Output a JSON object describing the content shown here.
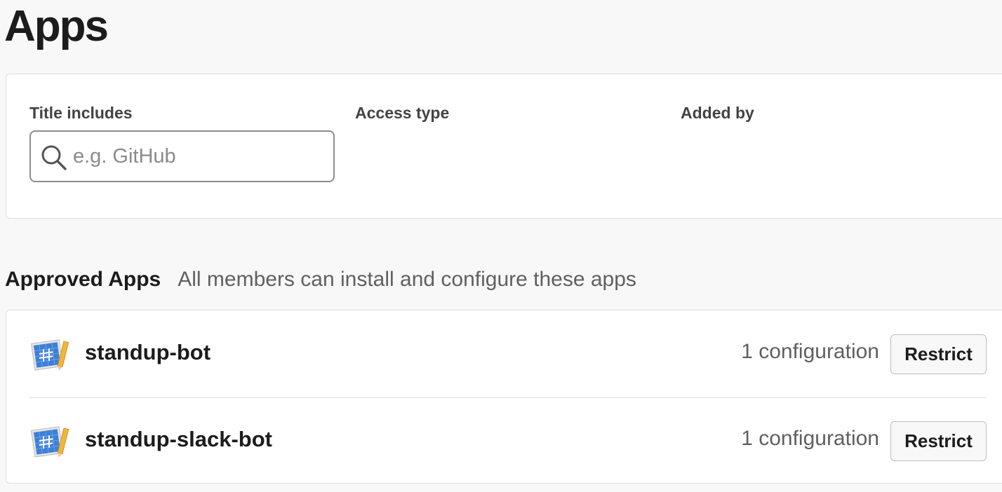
{
  "page": {
    "title": "Apps"
  },
  "filters": {
    "title_label": "Title includes",
    "title_placeholder": "e.g. GitHub",
    "title_value": "",
    "access_type_label": "Access type",
    "added_by_label": "Added by"
  },
  "approved": {
    "title": "Approved Apps",
    "subtitle": "All members can install and configure these apps",
    "apps": [
      {
        "name": "standup-bot",
        "icon": "app-blueprint-icon",
        "config_count": "1 configuration",
        "action_label": "Restrict"
      },
      {
        "name": "standup-slack-bot",
        "icon": "app-blueprint-icon",
        "config_count": "1 configuration",
        "action_label": "Restrict"
      }
    ]
  },
  "colors": {
    "background": "#f8f8f8",
    "card": "#ffffff",
    "border": "#dddddd",
    "text": "#1d1c1d",
    "muted_text": "#616061",
    "icon_blue": "#3d7fd6",
    "icon_pencil": "#f0b53b"
  }
}
